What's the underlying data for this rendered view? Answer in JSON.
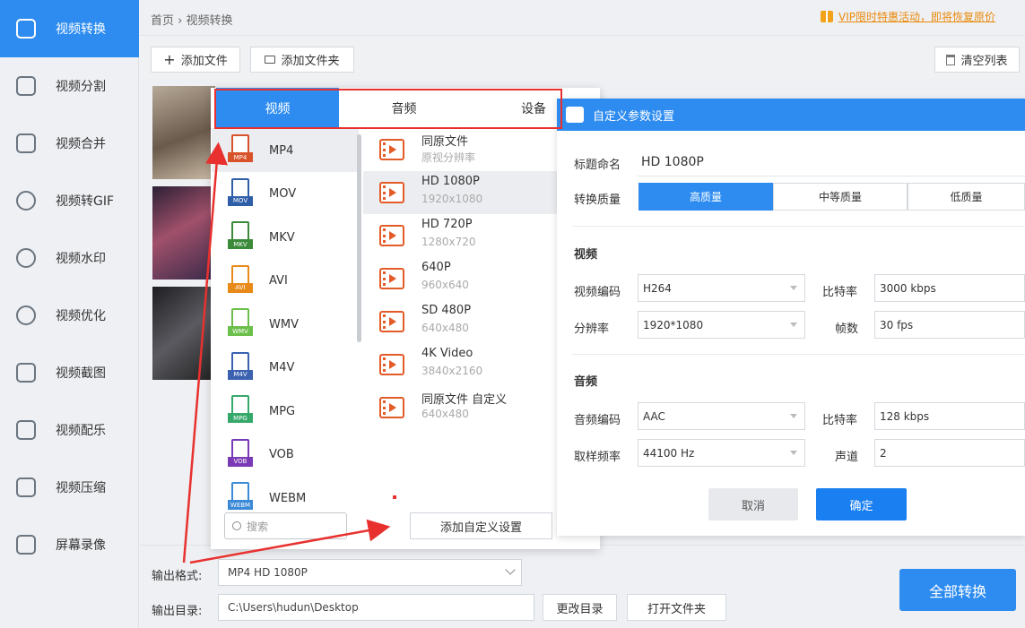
{
  "sidebar": {
    "items": [
      {
        "label": "视频转换",
        "icon": "convert-icon"
      },
      {
        "label": "视频分割",
        "icon": "split-icon"
      },
      {
        "label": "视频合并",
        "icon": "merge-icon"
      },
      {
        "label": "视频转GIF",
        "icon": "gif-icon"
      },
      {
        "label": "视频水印",
        "icon": "watermark-icon"
      },
      {
        "label": "视频优化",
        "icon": "optimize-icon"
      },
      {
        "label": "视频截图",
        "icon": "screenshot-icon"
      },
      {
        "label": "视频配乐",
        "icon": "music-icon"
      },
      {
        "label": "视频压缩",
        "icon": "compress-icon"
      },
      {
        "label": "屏幕录像",
        "icon": "record-icon"
      }
    ]
  },
  "header": {
    "breadcrumb": "首页 › 视频转换",
    "vip": "VIP限时特惠活动，即将恢复原价"
  },
  "toolbar": {
    "add_file": "添加文件",
    "add_folder": "添加文件夹",
    "clear_list": "清空列表"
  },
  "popup": {
    "tabs": [
      "视频",
      "音频",
      "设备"
    ],
    "formats": [
      {
        "name": "MP4",
        "color": "#d8522a"
      },
      {
        "name": "MOV",
        "color": "#2e5ea8"
      },
      {
        "name": "MKV",
        "color": "#3a8a3a"
      },
      {
        "name": "AVI",
        "color": "#e88a1a"
      },
      {
        "name": "WMV",
        "color": "#6cbf4a"
      },
      {
        "name": "M4V",
        "color": "#3a62b0"
      },
      {
        "name": "MPG",
        "color": "#36a86a"
      },
      {
        "name": "VOB",
        "color": "#7a3ab5"
      },
      {
        "name": "WEBM",
        "color": "#3a8ad8"
      }
    ],
    "presets": [
      {
        "name": "同原文件",
        "sub": "原视分辨率"
      },
      {
        "name": "HD 1080P",
        "sub": "1920x1080"
      },
      {
        "name": "HD 720P",
        "sub": "1280x720"
      },
      {
        "name": "640P",
        "sub": "960x640"
      },
      {
        "name": "SD 480P",
        "sub": "640x480"
      },
      {
        "name": "4K Video",
        "sub": "3840x2160"
      },
      {
        "name": "同原文件 自定义",
        "sub": "640x480"
      }
    ],
    "search_placeholder": "搜索",
    "add_custom": "添加自定义设置"
  },
  "settings": {
    "title": "自定义参数设置",
    "title_label": "标题命名",
    "title_value": "HD 1080P",
    "quality_label": "转换质量",
    "quality_options": [
      "高质量",
      "中等质量",
      "低质量"
    ],
    "video_section": "视频",
    "video_codec_label": "视频编码",
    "video_codec": "H264",
    "bitrate_label": "比特率",
    "video_bitrate": "3000 kbps",
    "resolution_label": "分辨率",
    "resolution": "1920*1080",
    "fps_label": "帧数",
    "fps": "30 fps",
    "audio_section": "音频",
    "audio_codec_label": "音频编码",
    "audio_codec": "AAC",
    "audio_bitrate": "128 kbps",
    "samplerate_label": "取样频率",
    "samplerate": "44100 Hz",
    "channel_label": "声道",
    "channel": "2",
    "cancel": "取消",
    "ok": "确定"
  },
  "bottom": {
    "output_format_label": "输出格式:",
    "output_format": "MP4  HD 1080P",
    "output_dir_label": "输出目录:",
    "output_dir": "C:\\Users\\hudun\\Desktop",
    "change_dir": "更改目录",
    "open_folder": "打开文件夹",
    "convert_all": "全部转换"
  },
  "colors": {
    "accent": "#2e8cf0",
    "annotation": "#e8312f",
    "vip": "#e98a0b"
  }
}
